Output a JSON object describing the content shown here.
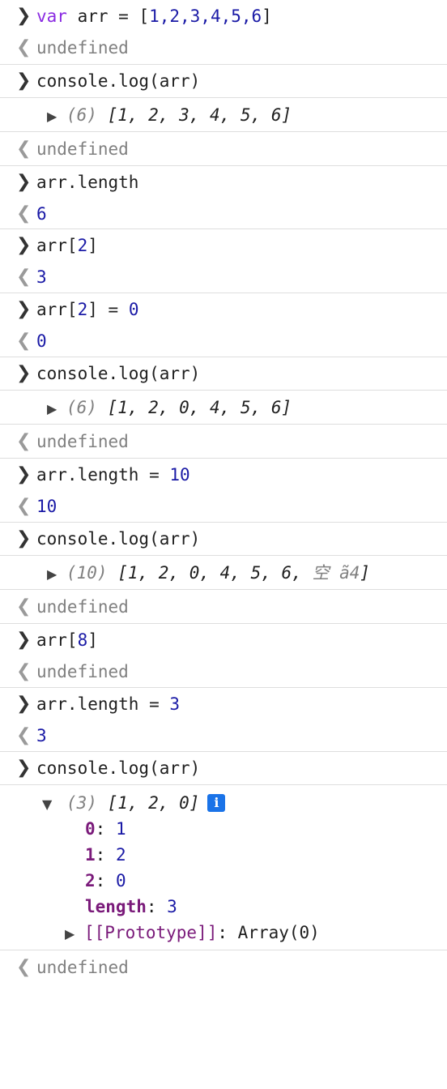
{
  "entries": {
    "e1_input": {
      "kw": "var",
      "rest": " arr = [",
      "nums": "1,2,3,4,5,6",
      "close": "]"
    },
    "e1_result": "undefined",
    "e2_input": "console.log(arr)",
    "e2_log": {
      "count": "(6)",
      "items": "[1, 2, 3, 4, 5, 6]"
    },
    "e2_result": "undefined",
    "e3_input": "arr.length",
    "e3_result": "6",
    "e4_input": {
      "pre": "arr[",
      "num": "2",
      "post": "]"
    },
    "e4_result": "3",
    "e5_input": {
      "pre": "arr[",
      "num": "2",
      "mid": "] = ",
      "val": "0"
    },
    "e5_result": "0",
    "e6_input": "console.log(arr)",
    "e6_log": {
      "count": "(6)",
      "items": "[1, 2, 0, 4, 5, 6]"
    },
    "e6_result": "undefined",
    "e7_input": {
      "pre": "arr.length = ",
      "val": "10"
    },
    "e7_result": "10",
    "e8_input": "console.log(arr)",
    "e8_log": {
      "count": "(10)",
      "items": "[1, 2, 0, 4, 5, 6, ",
      "empty": "空 ã4",
      "close": "]"
    },
    "e8_result": "undefined",
    "e9_input": {
      "pre": "arr[",
      "num": "8",
      "post": "]"
    },
    "e9_result": "undefined",
    "e10_input": {
      "pre": "arr.length = ",
      "val": "3"
    },
    "e10_result": "3",
    "e11_input": "console.log(arr)",
    "e11_log": {
      "count": "(3)",
      "items": "[1, 2, 0]",
      "info_label": "i",
      "props": [
        {
          "key": "0",
          "value": "1"
        },
        {
          "key": "1",
          "value": "2"
        },
        {
          "key": "2",
          "value": "0"
        },
        {
          "key": "length",
          "value": "3"
        }
      ],
      "prototype_key": "[[Prototype]]",
      "prototype_value": "Array(0)"
    },
    "e11_result": "undefined"
  },
  "icons": {
    "input_prompt": "chevron-right-icon",
    "result_marker": "chevron-left-icon",
    "expand_collapsed": "triangle-right-icon",
    "expand_open": "triangle-down-icon",
    "info": "info-icon"
  },
  "colors": {
    "keyword": "#8a2be2",
    "number": "#1a1aa6",
    "property_key": "#7a1a7a",
    "info_badge": "#1a73e8",
    "muted": "#808080"
  }
}
